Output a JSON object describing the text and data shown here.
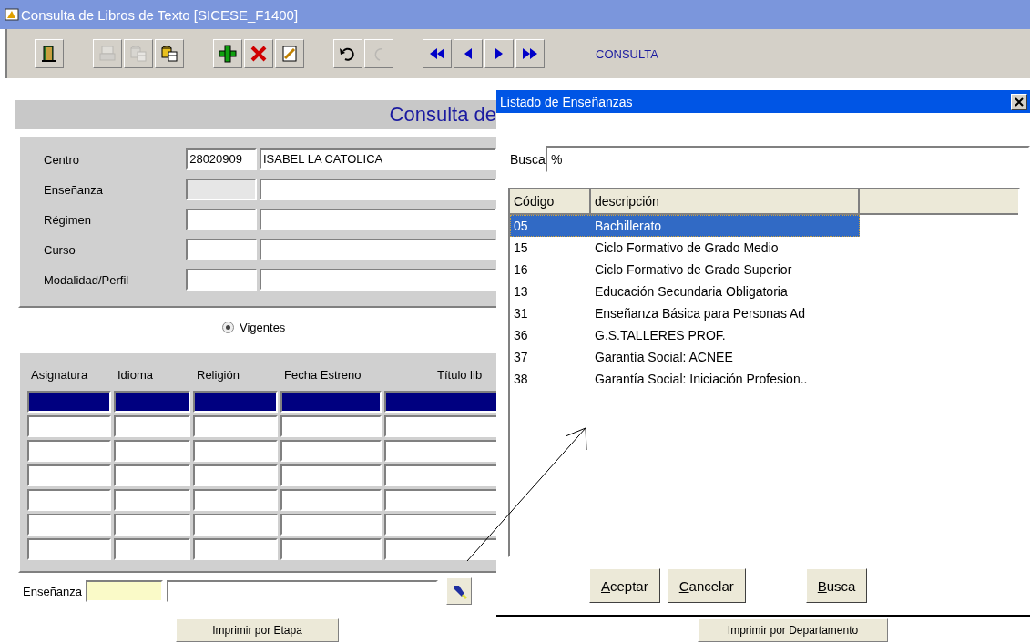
{
  "window": {
    "title": "Consulta de Libros de Texto [SICESE_F1400]"
  },
  "toolbar": {
    "groups": [
      {
        "buttons": [
          {
            "kind": "exit",
            "disabled": false
          }
        ]
      },
      {
        "buttons": [
          {
            "kind": "print",
            "disabled": true
          },
          {
            "kind": "database",
            "disabled": true
          },
          {
            "kind": "database",
            "disabled": false
          }
        ]
      },
      {
        "buttons": [
          {
            "kind": "add",
            "disabled": false
          },
          {
            "kind": "delete",
            "disabled": false
          },
          {
            "kind": "edit",
            "disabled": false
          }
        ]
      },
      {
        "buttons": [
          {
            "kind": "undo",
            "disabled": false
          },
          {
            "kind": "redo",
            "disabled": true
          }
        ]
      },
      {
        "buttons": [
          {
            "kind": "first",
            "disabled": false
          },
          {
            "kind": "prev",
            "disabled": false
          },
          {
            "kind": "next",
            "disabled": false
          },
          {
            "kind": "last",
            "disabled": false
          }
        ]
      }
    ],
    "mode": "CONSULTA"
  },
  "form": {
    "heading": "Consulta de",
    "fields": [
      {
        "label": "Centro",
        "code": "28020909",
        "description": "ISABEL LA CATOLICA",
        "disabled": false
      },
      {
        "label": "Enseñanza",
        "disabled": true
      },
      {
        "label": "Régimen",
        "disabled": false
      },
      {
        "label": "Curso",
        "disabled": false
      },
      {
        "label": "Modalidad/Perfil",
        "disabled": false
      }
    ]
  },
  "filter": {
    "label": "Vigentes",
    "selected": true
  },
  "table": {
    "columns": [
      "Asignatura",
      "Idioma",
      "Religión",
      "Fecha Estreno",
      "Título lib"
    ],
    "rows": [
      {
        "selected": true
      },
      {
        "selected": false
      },
      {
        "selected": false
      },
      {
        "selected": false
      },
      {
        "selected": false
      },
      {
        "selected": false
      },
      {
        "selected": false
      }
    ]
  },
  "lookup": {
    "label": "Enseñanza",
    "highlighted": true
  },
  "buttons": [
    "Imprimir por Etapa",
    "Imprimir por Departamento"
  ],
  "dialog": {
    "title": "Listado de Enseñanzas",
    "search": {
      "label": "Busca",
      "value": "%"
    },
    "columns": [
      "Código",
      "descripción"
    ],
    "rows": [
      {
        "code": "05",
        "description": "Bachillerato",
        "selected": true
      },
      {
        "code": "15",
        "description": "Ciclo Formativo de Grado Medio",
        "selected": false
      },
      {
        "code": "16",
        "description": "Ciclo Formativo de Grado Superior",
        "selected": false
      },
      {
        "code": "13",
        "description": "Educación Secundaria Obligatoria",
        "selected": false
      },
      {
        "code": "31",
        "description": "Enseñanza Básica para Personas Ad",
        "selected": false
      },
      {
        "code": "36",
        "description": "G.S.TALLERES PROF.",
        "selected": false
      },
      {
        "code": "37",
        "description": "Garantía Social: ACNEE",
        "selected": false
      },
      {
        "code": "38",
        "description": "Garantía Social: Iniciación Profesion..",
        "selected": false
      }
    ],
    "buttons": [
      {
        "label": "Aceptar",
        "mnemonic": true
      },
      {
        "label": "Cancelar",
        "mnemonic": true
      },
      {
        "label": "Busca",
        "mnemonic": true
      }
    ]
  }
}
